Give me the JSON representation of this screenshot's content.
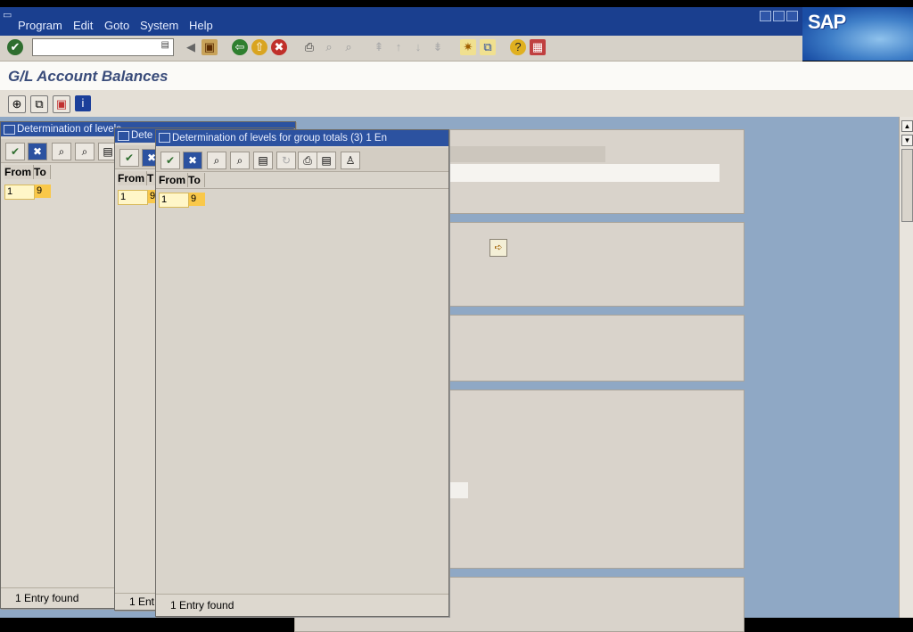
{
  "menu": [
    "Program",
    "Edit",
    "Goto",
    "System",
    "Help"
  ],
  "brand": "SAP",
  "page_title": "G/L Account Balances",
  "popups": [
    {
      "title": "Determination of levels",
      "col_from": "From",
      "col_to": "To",
      "from": "1",
      "to": "9",
      "status": "1 Entry found"
    },
    {
      "title": "Dete",
      "col_from": "From",
      "col_to": "T",
      "from": "1",
      "to": "9",
      "status": "1 Ent"
    },
    {
      "title": "Determination of levels for group totals (3)    1 En",
      "col_from": "From",
      "col_to": "To",
      "from": "1",
      "to": "9",
      "status": "1 Entry found"
    }
  ],
  "colors": {
    "menubar": "#1a3f8f",
    "title_text": "#3a4c7a",
    "popup_title": "#2c52a0",
    "highlight": "#f9c84a"
  }
}
